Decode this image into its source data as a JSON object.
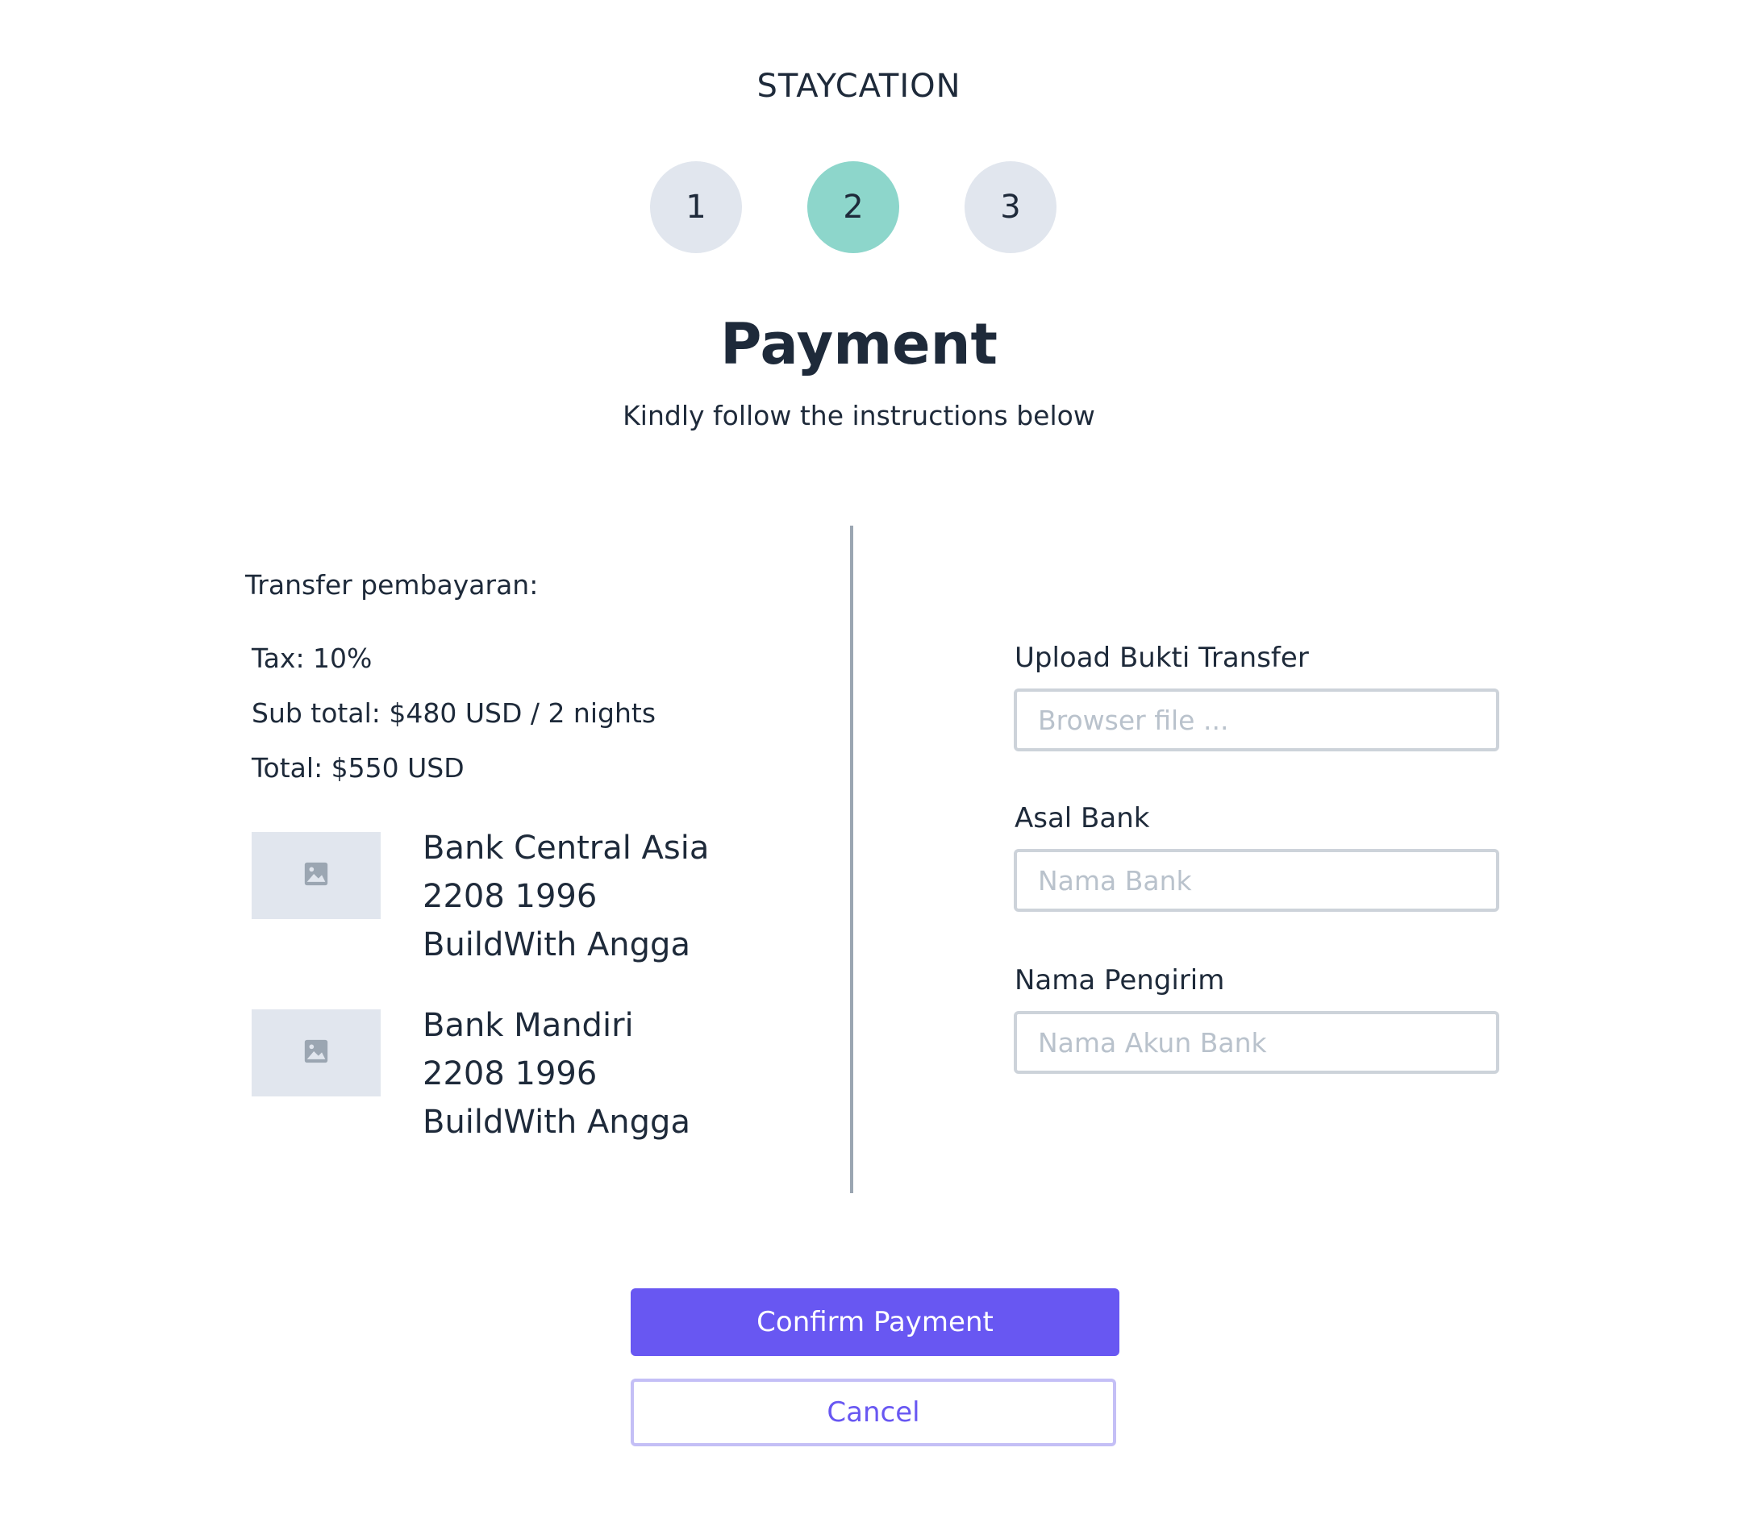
{
  "brand": "STAYCATION",
  "steps": [
    "1",
    "2",
    "3"
  ],
  "active_step": "2",
  "title": "Payment",
  "subtitle": "Kindly follow the instructions below",
  "left": {
    "heading": "Transfer pembayaran:",
    "tax": "Tax: 10%",
    "subtotal": "Sub total: $480 USD / 2 nights",
    "total": "Total: $550 USD",
    "banks": [
      {
        "name": "Bank Central Asia",
        "number": "2208 1996",
        "holder": "BuildWith Angga",
        "logo_icon": "image-placeholder-icon"
      },
      {
        "name": "Bank Mandiri",
        "number": "2208 1996",
        "holder": "BuildWith Angga",
        "logo_icon": "image-placeholder-icon"
      }
    ]
  },
  "form": {
    "upload_label": "Upload Bukti Transfer",
    "upload_placeholder": "Browser file ...",
    "bank_label": "Asal Bank",
    "bank_placeholder": "Nama Bank",
    "sender_label": "Nama Pengirim",
    "sender_placeholder": "Nama Akun Bank"
  },
  "buttons": {
    "confirm": "Confirm Payment",
    "cancel": "Cancel"
  },
  "colors": {
    "accent": "#6857f2",
    "step_active": "#8dd6cb",
    "step_inactive": "#e1e6ee",
    "text": "#1e2a3a"
  }
}
